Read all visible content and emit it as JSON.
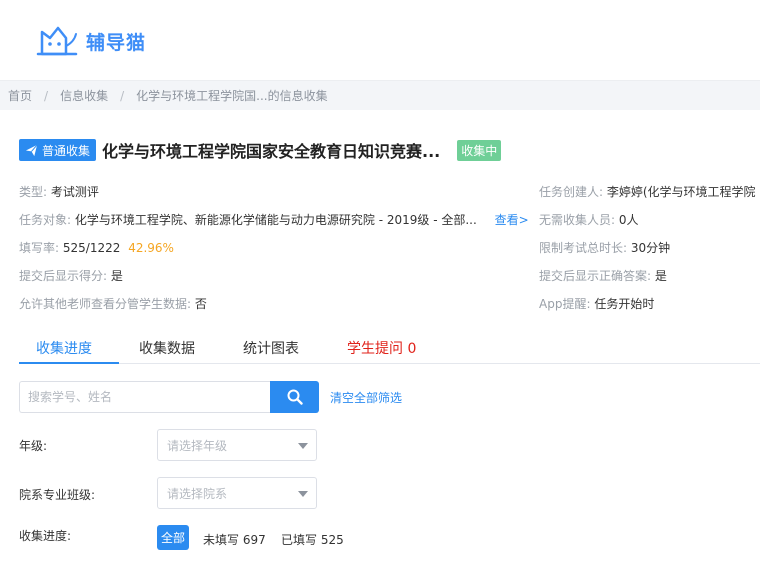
{
  "brand": {
    "name": "辅导猫",
    "color": "#3f8ef7"
  },
  "breadcrumb": [
    "首页",
    "信息收集",
    "化学与环境工程学院国...的信息收集"
  ],
  "task": {
    "type_tag": "普通收集",
    "title": "化学与环境工程学院国家安全教育日知识竞赛...",
    "status": "收集中"
  },
  "info_left": {
    "category_label": "类型:",
    "category_value": "考试测评",
    "target_label": "任务对象:",
    "target_value": "化学与环境工程学院、新能源化学储能与动力电源研究院 - 2019级 - 全部...",
    "view_link": "查看>",
    "fill_label": "填写率:",
    "fill_value": "525/1222",
    "fill_pct": "42.96%",
    "score_label": "提交后显示得分:",
    "score_value": "是",
    "others_label": "允许其他老师查看分管学生数据:",
    "others_value": "否"
  },
  "info_right": {
    "creator_label": "任务创建人:",
    "creator_value": "李婷婷(化学与环境工程学院",
    "exempt_label": "无需收集人员:",
    "exempt_value": "0人",
    "time_label": "限制考试总时长:",
    "time_value": "30分钟",
    "answer_label": "提交后显示正确答案:",
    "answer_value": "是",
    "app_label": "App提醒:",
    "app_value": "任务开始时"
  },
  "tabs": [
    "收集进度",
    "收集数据",
    "统计图表",
    "学生提问 0"
  ],
  "search": {
    "placeholder": "搜索学号、姓名",
    "clear_label": "清空全部筛选"
  },
  "filters": {
    "grade_label": "年级:",
    "grade_placeholder": "请选择年级",
    "dept_label": "院系专业班级:",
    "dept_placeholder": "请选择院系",
    "progress_label": "收集进度:",
    "progress_options": [
      "全部",
      "未填写 697",
      "已填写 525"
    ]
  },
  "colors": {
    "accent": "#2b8bf0",
    "status": "#6fcf97",
    "highlight": "#f5a623",
    "alert": "#e0221a"
  }
}
